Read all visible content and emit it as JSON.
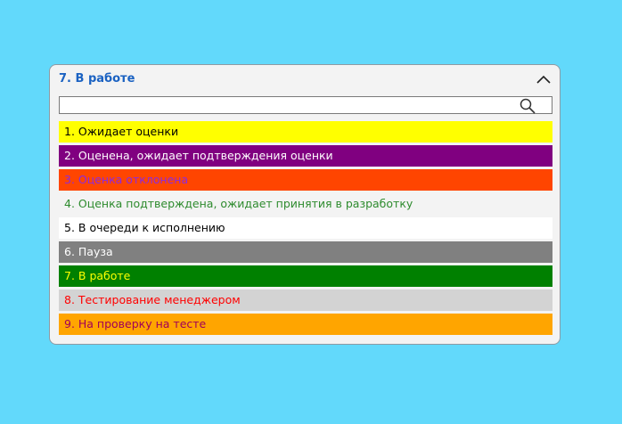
{
  "header": {
    "title": "7. В работе",
    "collapse_icon": "chevron-up-icon"
  },
  "search": {
    "value": "",
    "placeholder": "",
    "icon": "search-icon"
  },
  "statuses": [
    {
      "label": "1. Ожидает оценки",
      "bg": "#ffff00",
      "color": "#000000"
    },
    {
      "label": "2. Оценена, ожидает подтверждения оценки",
      "bg": "#800080",
      "color": "#ffffff"
    },
    {
      "label": "3. Оценка отклонена",
      "bg": "#ff4500",
      "color": "#8a2be2"
    },
    {
      "label": "4. Оценка подтверждена, ожидает принятия в разработку",
      "bg": "#f3f3f3",
      "color": "#2e8b2e"
    },
    {
      "label": "5. В очереди к исполнению",
      "bg": "#ffffff",
      "color": "#000000"
    },
    {
      "label": "6. Пауза",
      "bg": "#808080",
      "color": "#ffffff"
    },
    {
      "label": "7. В работе",
      "bg": "#008000",
      "color": "#ffff00"
    },
    {
      "label": "8. Тестирование менеджером",
      "bg": "#d3d3d3",
      "color": "#ff0000"
    },
    {
      "label": "9. На проверку на тесте",
      "bg": "#ffa500",
      "color": "#a0005a"
    }
  ]
}
